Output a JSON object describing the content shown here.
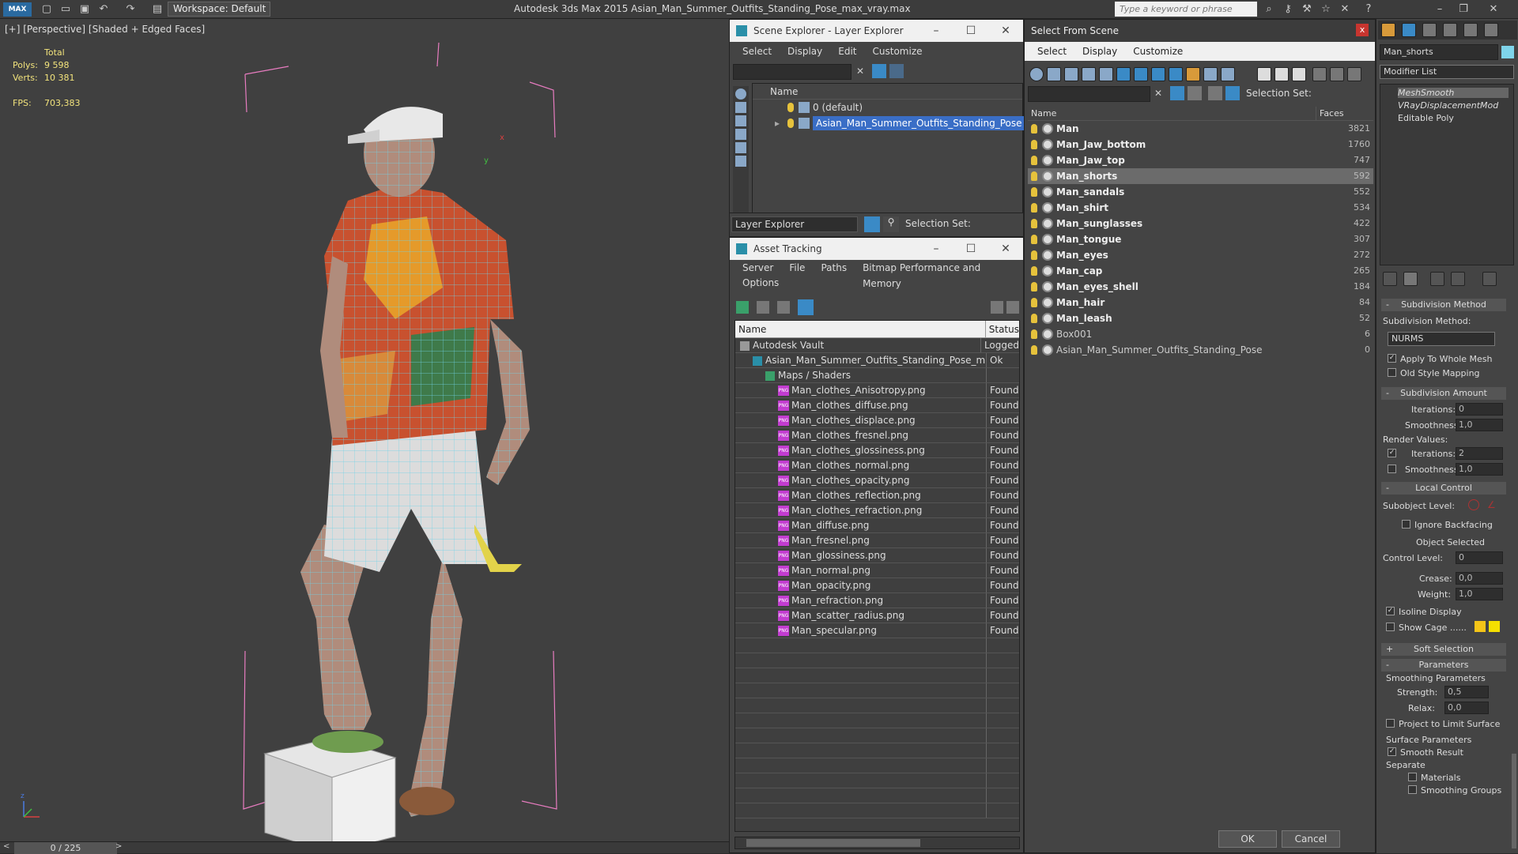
{
  "titlebar": {
    "app_title": "Autodesk 3ds Max  2015    Asian_Man_Summer_Outfits_Standing_Pose_max_vray.max",
    "workspace": "Workspace: Default",
    "search_placeholder": "Type a keyword or phrase",
    "logo": "MAX"
  },
  "viewport": {
    "label": "[+] [Perspective] [Shaded + Edged Faces]",
    "stats": {
      "total_label": "Total",
      "polys_label": "Polys:",
      "polys_value": "9 598",
      "verts_label": "Verts:",
      "verts_value": "10 381",
      "fps_label": "FPS:",
      "fps_value": "703,383"
    },
    "axis": {
      "x": "x",
      "y": "y",
      "z": "z"
    }
  },
  "timeline": {
    "frame": "0 / 225"
  },
  "scene_explorer": {
    "title": "Scene Explorer - Layer Explorer",
    "menu": [
      "Select",
      "Display",
      "Edit",
      "Customize"
    ],
    "column_name": "Name",
    "layers": [
      {
        "name": "0 (default)",
        "selected": false
      },
      {
        "name": "Asian_Man_Summer_Outfits_Standing_Pose",
        "selected": true
      }
    ],
    "layer_explorer_label": "Layer Explorer",
    "selection_set_label": "Selection Set:"
  },
  "asset_tracking": {
    "title": "Asset Tracking",
    "menu": [
      "Server",
      "File",
      "Paths",
      "Bitmap Performance and Memory"
    ],
    "menu2": [
      "Options"
    ],
    "columns": {
      "name": "Name",
      "status": "Status"
    },
    "rows": [
      {
        "name": "Autodesk Vault",
        "status": "Logged",
        "indent": 0,
        "type": "vault"
      },
      {
        "name": "Asian_Man_Summer_Outfits_Standing_Pose_m...",
        "status": "Ok",
        "indent": 1,
        "type": "max"
      },
      {
        "name": "Maps / Shaders",
        "status": "",
        "indent": 2,
        "type": "folder"
      },
      {
        "name": "Man_clothes_Anisotropy.png",
        "status": "Found",
        "indent": 3,
        "type": "png"
      },
      {
        "name": "Man_clothes_diffuse.png",
        "status": "Found",
        "indent": 3,
        "type": "png"
      },
      {
        "name": "Man_clothes_displace.png",
        "status": "Found",
        "indent": 3,
        "type": "png"
      },
      {
        "name": "Man_clothes_fresnel.png",
        "status": "Found",
        "indent": 3,
        "type": "png"
      },
      {
        "name": "Man_clothes_glossiness.png",
        "status": "Found",
        "indent": 3,
        "type": "png"
      },
      {
        "name": "Man_clothes_normal.png",
        "status": "Found",
        "indent": 3,
        "type": "png"
      },
      {
        "name": "Man_clothes_opacity.png",
        "status": "Found",
        "indent": 3,
        "type": "png"
      },
      {
        "name": "Man_clothes_reflection.png",
        "status": "Found",
        "indent": 3,
        "type": "png"
      },
      {
        "name": "Man_clothes_refraction.png",
        "status": "Found",
        "indent": 3,
        "type": "png"
      },
      {
        "name": "Man_diffuse.png",
        "status": "Found",
        "indent": 3,
        "type": "png"
      },
      {
        "name": "Man_fresnel.png",
        "status": "Found",
        "indent": 3,
        "type": "png"
      },
      {
        "name": "Man_glossiness.png",
        "status": "Found",
        "indent": 3,
        "type": "png"
      },
      {
        "name": "Man_normal.png",
        "status": "Found",
        "indent": 3,
        "type": "png"
      },
      {
        "name": "Man_opacity.png",
        "status": "Found",
        "indent": 3,
        "type": "png"
      },
      {
        "name": "Man_refraction.png",
        "status": "Found",
        "indent": 3,
        "type": "png"
      },
      {
        "name": "Man_scatter_radius.png",
        "status": "Found",
        "indent": 3,
        "type": "png"
      },
      {
        "name": "Man_specular.png",
        "status": "Found",
        "indent": 3,
        "type": "png"
      }
    ],
    "png_badge": "PNG"
  },
  "select_from_scene": {
    "title": "Select From Scene",
    "close": "x",
    "menu": [
      "Select",
      "Display",
      "Customize"
    ],
    "selection_set_label": "Selection Set:",
    "columns": {
      "name": "Name",
      "faces": "Faces"
    },
    "objects": [
      {
        "name": "Man",
        "faces": "3821",
        "bold": true,
        "selected": false
      },
      {
        "name": "Man_Jaw_bottom",
        "faces": "1760",
        "bold": true,
        "selected": false
      },
      {
        "name": "Man_Jaw_top",
        "faces": "747",
        "bold": true,
        "selected": false
      },
      {
        "name": "Man_shorts",
        "faces": "592",
        "bold": true,
        "selected": true
      },
      {
        "name": "Man_sandals",
        "faces": "552",
        "bold": true,
        "selected": false
      },
      {
        "name": "Man_shirt",
        "faces": "534",
        "bold": true,
        "selected": false
      },
      {
        "name": "Man_sunglasses",
        "faces": "422",
        "bold": true,
        "selected": false
      },
      {
        "name": "Man_tongue",
        "faces": "307",
        "bold": true,
        "selected": false
      },
      {
        "name": "Man_eyes",
        "faces": "272",
        "bold": true,
        "selected": false
      },
      {
        "name": "Man_cap",
        "faces": "265",
        "bold": true,
        "selected": false
      },
      {
        "name": "Man_eyes_shell",
        "faces": "184",
        "bold": true,
        "selected": false
      },
      {
        "name": "Man_hair",
        "faces": "84",
        "bold": true,
        "selected": false
      },
      {
        "name": "Man_leash",
        "faces": "52",
        "bold": true,
        "selected": false
      },
      {
        "name": "Box001",
        "faces": "6",
        "bold": false,
        "selected": false
      },
      {
        "name": "Asian_Man_Summer_Outfits_Standing_Pose",
        "faces": "0",
        "bold": false,
        "selected": false
      }
    ],
    "ok_label": "OK",
    "cancel_label": "Cancel"
  },
  "command_panel": {
    "object_name": "Man_shorts",
    "modifier_list": "Modifier List",
    "stack": [
      "MeshSmooth",
      "VRayDisplacementMod",
      "Editable Poly"
    ],
    "subdivision_method": {
      "rollout": "Subdivision Method",
      "label": "Subdivision Method:",
      "value": "NURMS",
      "apply_whole_mesh": "Apply To Whole Mesh",
      "old_style_mapping": "Old Style Mapping"
    },
    "subdivision_amount": {
      "rollout": "Subdivision Amount",
      "iterations_label": "Iterations:",
      "iterations": "0",
      "smoothness_label": "Smoothness:",
      "smoothness": "1,0",
      "render_values": "Render Values:",
      "render_iterations": "2",
      "render_smoothness": "1,0"
    },
    "local_control": {
      "rollout": "Local Control",
      "subobject_level": "Subobject Level:",
      "ignore_backfacing": "Ignore Backfacing",
      "object_selected": "Object Selected",
      "control_level_label": "Control Level:",
      "control_level": "0",
      "crease_label": "Crease:",
      "crease": "0,0",
      "weight_label": "Weight:",
      "weight": "1,0",
      "isoline_display": "Isoline Display",
      "show_cage": "Show Cage ......"
    },
    "soft_selection": {
      "rollout": "Soft Selection"
    },
    "parameters": {
      "rollout": "Parameters",
      "smoothing_parameters": "Smoothing Parameters",
      "strength_label": "Strength:",
      "strength": "0,5",
      "relax_label": "Relax:",
      "relax": "0,0",
      "project_limit": "Project to Limit Surface",
      "surface_parameters": "Surface Parameters",
      "smooth_result": "Smooth Result",
      "separate": "Separate",
      "materials": "Materials",
      "smoothing_groups": "Smoothing Groups"
    },
    "colors": {
      "cage1": "#f5c518",
      "cage2": "#f5e000",
      "swatch": "#7fd4ea"
    }
  }
}
